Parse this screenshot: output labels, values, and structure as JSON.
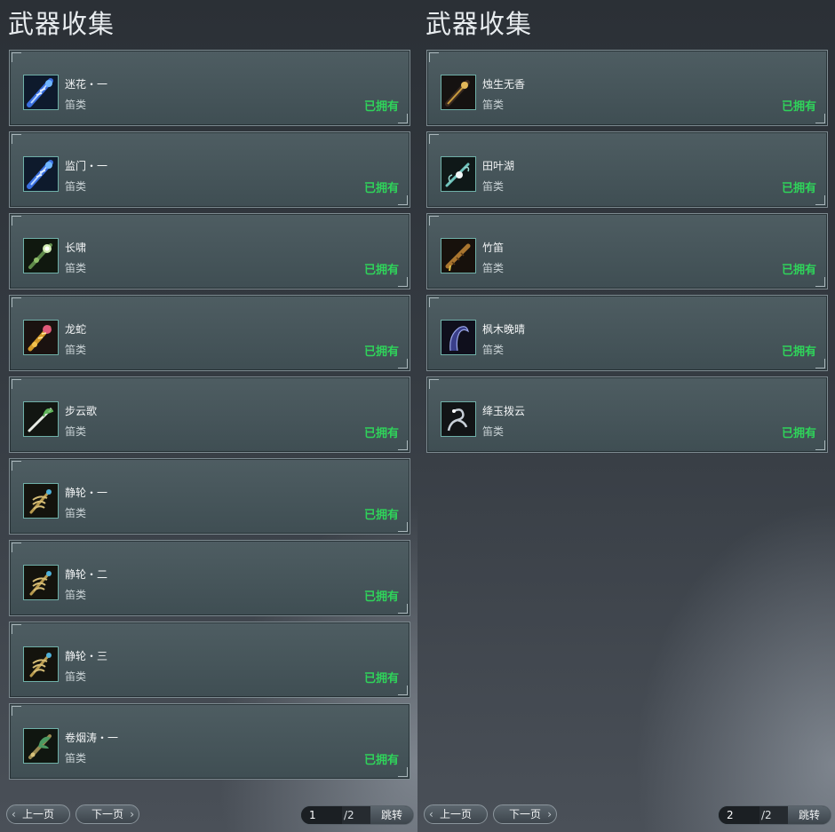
{
  "left_panel": {
    "title": "武器收集",
    "items": [
      {
        "name": "迷花・一",
        "type": "笛类",
        "status": "已拥有",
        "icon": "blue-flute-icon"
      },
      {
        "name": "监门・一",
        "type": "笛类",
        "status": "已拥有",
        "icon": "blue-flute-icon"
      },
      {
        "name": "长啸",
        "type": "笛类",
        "status": "已拥有",
        "icon": "green-orb-flute-icon"
      },
      {
        "name": "龙蛇",
        "type": "笛类",
        "status": "已拥有",
        "icon": "golden-dragon-flute-icon"
      },
      {
        "name": "步云歌",
        "type": "笛类",
        "status": "已拥有",
        "icon": "white-leaf-flute-icon"
      },
      {
        "name": "静轮・一",
        "type": "笛类",
        "status": "已拥有",
        "icon": "golden-claw-flute-icon"
      },
      {
        "name": "静轮・二",
        "type": "笛类",
        "status": "已拥有",
        "icon": "golden-claw-flute-icon"
      },
      {
        "name": "静轮・三",
        "type": "笛类",
        "status": "已拥有",
        "icon": "golden-claw-flute-icon"
      },
      {
        "name": "卷烟涛・一",
        "type": "笛类",
        "status": "已拥有",
        "icon": "green-dragon-flute-icon"
      }
    ],
    "pagination": {
      "prev_label": "上一页",
      "next_label": "下一页",
      "current_page": "1",
      "total_pages": "/2",
      "jump_label": "跳转"
    }
  },
  "right_panel": {
    "title": "武器收集",
    "items": [
      {
        "name": "烛生无香",
        "type": "笛类",
        "status": "已拥有",
        "icon": "dark-gold-flute-icon"
      },
      {
        "name": "田叶湖",
        "type": "笛类",
        "status": "已拥有",
        "icon": "lotus-flute-icon"
      },
      {
        "name": "竹笛",
        "type": "笛类",
        "status": "已拥有",
        "icon": "bamboo-flute-icon"
      },
      {
        "name": "枫木晚晴",
        "type": "笛类",
        "status": "已拥有",
        "icon": "purple-serpent-flute-icon"
      },
      {
        "name": "绛玉拨云",
        "type": "笛类",
        "status": "已拥有",
        "icon": "silver-dragon-flute-icon"
      }
    ],
    "pagination": {
      "prev_label": "上一页",
      "next_label": "下一页",
      "current_page": "2",
      "total_pages": "/2",
      "jump_label": "跳转"
    }
  },
  "colors": {
    "owned_text": "#2fd35a",
    "card_border": "#7d8a90",
    "icon_border": "#6fb0a8"
  }
}
